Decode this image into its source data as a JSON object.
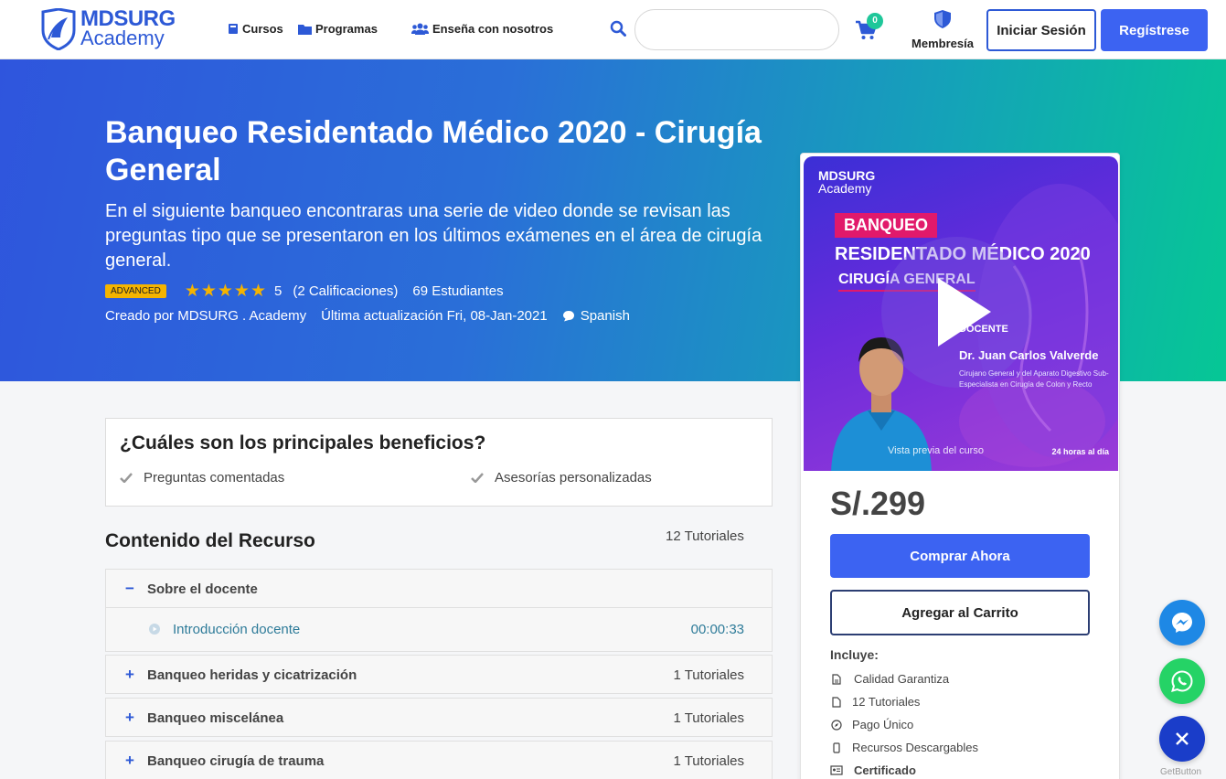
{
  "header": {
    "logo_line1": "MDSURG",
    "logo_line2": "Academy",
    "nav": [
      {
        "label": "Cursos",
        "icon": "book-icon"
      },
      {
        "label": "Programas",
        "icon": "folder-icon"
      },
      {
        "label": "Enseña con nosotros",
        "icon": "users-icon"
      }
    ],
    "search_placeholder": "",
    "cart_count": "0",
    "membership_label": "Membresía",
    "login_label": "Iniciar Sesión",
    "register_label": "Regístrese"
  },
  "hero": {
    "title": "Banqueo Residentado Médico 2020 - Cirugía General",
    "description": "En el siguiente banqueo encontraras una serie de video donde se revisan las preguntas tipo que se presentaron en los últimos exámenes en el área de cirugía general.",
    "level": "ADVANCED",
    "rating": 5,
    "rating_text": "5",
    "ratings_count": "(2 Calificaciones)",
    "students": "69 Estudiantes",
    "created_by": "Creado por MDSURG . Academy",
    "last_update": "Última actualización Fri, 08-Jan-2021",
    "language": "Spanish"
  },
  "video": {
    "logo_line1": "MDSURG",
    "logo_line2": "Academy",
    "tag": "BANQUEO",
    "headline": "RESIDENTADO MÉDICO 2020",
    "subheadline": "CIRUGÍA GENERAL",
    "docente_label": "DOCENTE",
    "docente_name": "Dr. Juan Carlos Valverde",
    "docente_desc": "Cirujano General y del Aparato Digestivo Sub-Especialista en Cirugía de Colon y Recto",
    "preview_label": "Vista previa del curso",
    "footer_text": "24 horas al día"
  },
  "purchase": {
    "price": "S/.299",
    "buy_label": "Comprar Ahora",
    "cart_label": "Agregar al Carrito",
    "includes_label": "Incluye:",
    "includes": [
      {
        "label": "Calidad Garantiza",
        "icon": "file-icon"
      },
      {
        "label": "12 Tutoriales",
        "icon": "document-icon"
      },
      {
        "label": "Pago Único",
        "icon": "compass-icon"
      },
      {
        "label": "Recursos Descargables",
        "icon": "mobile-icon"
      },
      {
        "label": "Certificado",
        "icon": "certificate-icon"
      }
    ]
  },
  "benefits": {
    "title": "¿Cuáles son los principales beneficios?",
    "items": [
      "Preguntas comentadas",
      "Asesorías personalizadas"
    ]
  },
  "content": {
    "title": "Contenido del Recurso",
    "count": "12 Tutoriales",
    "sections": [
      {
        "sign": "−",
        "title": "Sobre el docente",
        "count": ""
      },
      {
        "sign": "+",
        "title": "Banqueo heridas y cicatrización",
        "count": "1 Tutoriales"
      },
      {
        "sign": "+",
        "title": "Banqueo miscelánea",
        "count": "1 Tutoriales"
      },
      {
        "sign": "+",
        "title": "Banqueo cirugía de trauma",
        "count": "1 Tutoriales"
      }
    ],
    "lesson": {
      "title": "Introducción docente",
      "time": "00:00:33"
    }
  },
  "floating": {
    "messenger_color": "#1e88e5",
    "whatsapp_color": "#25d366",
    "close_color": "#1a3dc9",
    "getbutton_label": "GetButton"
  }
}
